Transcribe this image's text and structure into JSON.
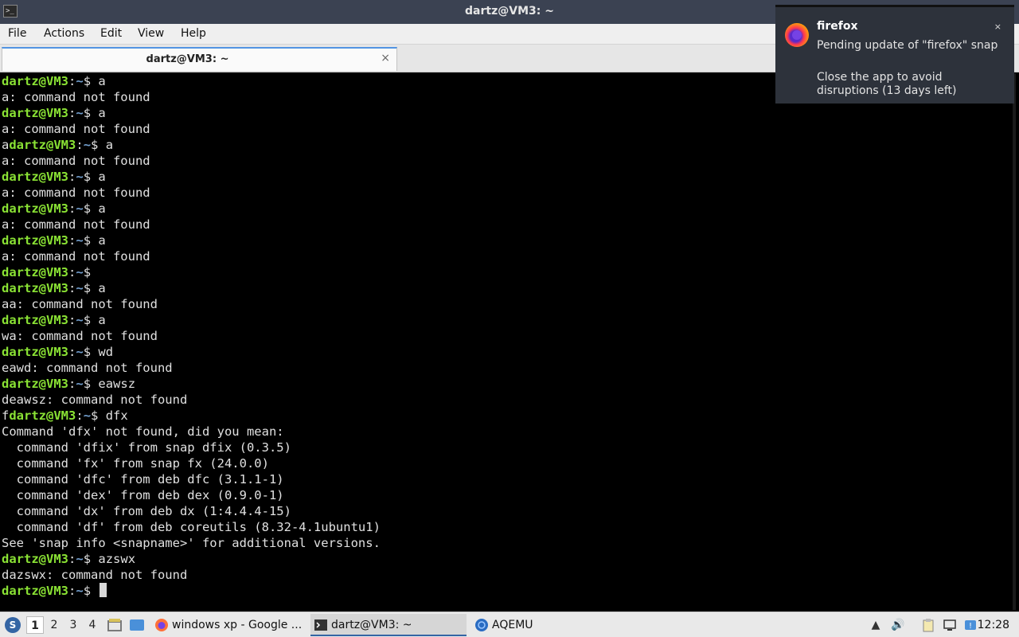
{
  "window": {
    "title": "dartz@VM3: ~",
    "app_icon_glyph": ">_"
  },
  "menu": [
    "File",
    "Actions",
    "Edit",
    "View",
    "Help"
  ],
  "tab": {
    "label": "dartz@VM3: ~",
    "close_glyph": "×"
  },
  "terminal": {
    "prompt_user": "dartz@VM3",
    "prompt_path": "~",
    "lines": [
      {
        "kind": "prompt",
        "pre": "",
        "cmd": " a"
      },
      {
        "kind": "out",
        "text": "a: command not found"
      },
      {
        "kind": "prompt",
        "pre": "",
        "cmd": " a"
      },
      {
        "kind": "out",
        "text": "a: command not found"
      },
      {
        "kind": "prompt",
        "pre": "a",
        "cmd": " a"
      },
      {
        "kind": "out",
        "text": "a: command not found"
      },
      {
        "kind": "prompt",
        "pre": "",
        "cmd": " a"
      },
      {
        "kind": "out",
        "text": "a: command not found"
      },
      {
        "kind": "prompt",
        "pre": "",
        "cmd": " a"
      },
      {
        "kind": "out",
        "text": "a: command not found"
      },
      {
        "kind": "prompt",
        "pre": "",
        "cmd": " a"
      },
      {
        "kind": "out",
        "text": "a: command not found"
      },
      {
        "kind": "prompt",
        "pre": "",
        "cmd": ""
      },
      {
        "kind": "prompt",
        "pre": "",
        "cmd": " a"
      },
      {
        "kind": "out",
        "text": "aa: command not found"
      },
      {
        "kind": "prompt",
        "pre": "",
        "cmd": " a"
      },
      {
        "kind": "out",
        "text": "wa: command not found"
      },
      {
        "kind": "prompt",
        "pre": "",
        "cmd": " wd"
      },
      {
        "kind": "out",
        "text": "eawd: command not found"
      },
      {
        "kind": "prompt",
        "pre": "",
        "cmd": " eawsz"
      },
      {
        "kind": "out",
        "text": "deawsz: command not found"
      },
      {
        "kind": "prompt",
        "pre": "f",
        "cmd": " dfx"
      },
      {
        "kind": "out",
        "text": "Command 'dfx' not found, did you mean:"
      },
      {
        "kind": "out",
        "text": "  command 'dfix' from snap dfix (0.3.5)"
      },
      {
        "kind": "out",
        "text": "  command 'fx' from snap fx (24.0.0)"
      },
      {
        "kind": "out",
        "text": "  command 'dfc' from deb dfc (3.1.1-1)"
      },
      {
        "kind": "out",
        "text": "  command 'dex' from deb dex (0.9.0-1)"
      },
      {
        "kind": "out",
        "text": "  command 'dx' from deb dx (1:4.4.4-15)"
      },
      {
        "kind": "out",
        "text": "  command 'df' from deb coreutils (8.32-4.1ubuntu1)"
      },
      {
        "kind": "out",
        "text": "See 'snap info <snapname>' for additional versions."
      },
      {
        "kind": "prompt",
        "pre": "",
        "cmd": " azswx"
      },
      {
        "kind": "out",
        "text": "dazswx: command not found"
      },
      {
        "kind": "prompt",
        "pre": "",
        "cmd": " ",
        "cursor": true
      }
    ]
  },
  "notification": {
    "app": "firefox",
    "close_glyph": "×",
    "line1": "Pending update of \"firefox\" snap",
    "line2": "Close the app to avoid disruptions (13 days left)"
  },
  "taskbar": {
    "workspaces": [
      "1",
      "2",
      "3",
      "4"
    ],
    "active_workspace": "1",
    "tasks": [
      {
        "label": "windows xp - Google ...",
        "icon": "firefox-icon"
      },
      {
        "label": "dartz@VM3: ~",
        "icon": "terminal-icon",
        "active": true
      },
      {
        "label": "AQEMU",
        "icon": "aqemu-icon"
      }
    ],
    "clock": "12:28"
  }
}
